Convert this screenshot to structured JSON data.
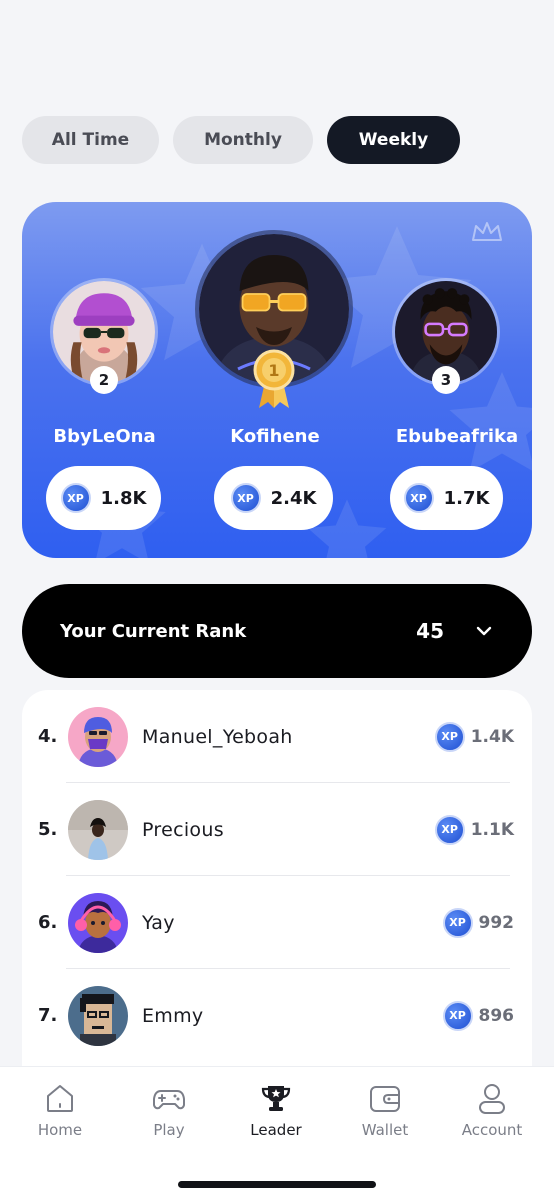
{
  "filters": {
    "all_time": "All Time",
    "monthly": "Monthly",
    "weekly": "Weekly",
    "selected": "Weekly"
  },
  "podium": {
    "xp_label": "XP",
    "second": {
      "rank": "2",
      "name": "BbyLeOna",
      "xp": "1.8K"
    },
    "first": {
      "rank": "1",
      "name": "Kofihene",
      "xp": "2.4K"
    },
    "third": {
      "rank": "3",
      "name": "Ebubeafrika",
      "xp": "1.7K"
    }
  },
  "current_rank": {
    "label": "Your Current Rank",
    "value": "45"
  },
  "leaderboard": [
    {
      "position": "4.",
      "name": "Manuel_Yeboah",
      "xp": "1.4K"
    },
    {
      "position": "5.",
      "name": "Precious",
      "xp": "1.1K"
    },
    {
      "position": "6.",
      "name": "Yay",
      "xp": "992"
    },
    {
      "position": "7.",
      "name": "Emmy",
      "xp": "896"
    }
  ],
  "nav": {
    "home": "Home",
    "play": "Play",
    "leader": "Leader",
    "wallet": "Wallet",
    "account": "Account",
    "active": "Leader"
  },
  "colors": {
    "accent_blue": "#2f5ff0",
    "active_tab": "#141925",
    "rank_bar": "#000000",
    "medal_gold": "#f2b63a"
  },
  "icons": {
    "home": "home-icon",
    "play": "gamepad-icon",
    "leader": "trophy-icon",
    "wallet": "wallet-icon",
    "account": "user-icon",
    "expand": "chevron-down-icon"
  }
}
